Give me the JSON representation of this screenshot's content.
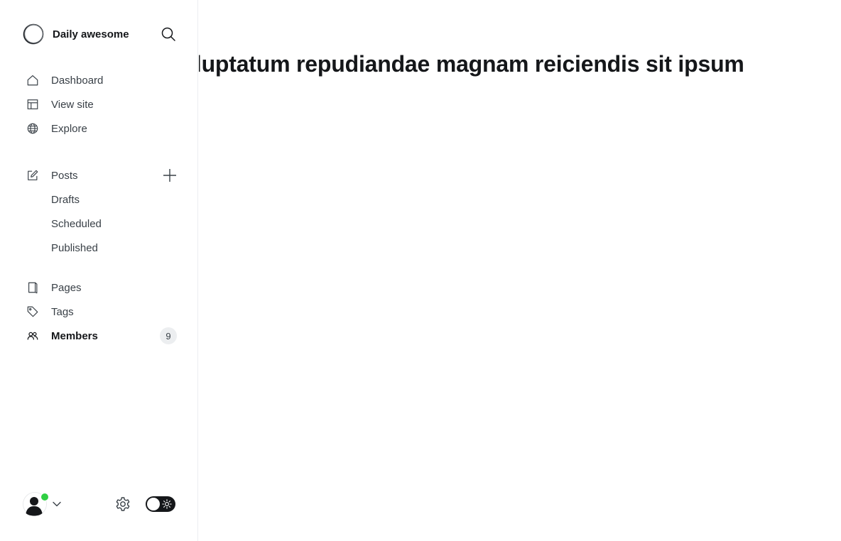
{
  "brand": {
    "title": "Daily awesome",
    "logo_icon": "circle-logo-icon"
  },
  "header": {
    "search_icon": "search-icon"
  },
  "nav": {
    "primary": [
      {
        "label": "Dashboard",
        "icon": "home-icon"
      },
      {
        "label": "View site",
        "icon": "layout-icon"
      },
      {
        "label": "Explore",
        "icon": "globe-icon"
      }
    ],
    "posts": {
      "label": "Posts",
      "icon": "edit-icon",
      "add_icon": "plus-icon",
      "sub": [
        "Drafts",
        "Scheduled",
        "Published"
      ]
    },
    "secondary": [
      {
        "label": "Pages",
        "icon": "page-icon"
      },
      {
        "label": "Tags",
        "icon": "tag-icon"
      },
      {
        "label": "Members",
        "icon": "users-icon",
        "count": "9",
        "active": true
      }
    ]
  },
  "footer": {
    "avatar_icon": "user-avatar-icon",
    "status_color": "#30cf43",
    "chevron_icon": "chevron-down-icon",
    "settings_icon": "gear-icon",
    "theme_toggle_icon": "sun-icon"
  },
  "main": {
    "title": "olorum voluptatum repudiandae magnam reiciendis sit ipsum"
  },
  "colors": {
    "text": "#15171a",
    "muted_text": "#394047",
    "badge_bg": "#eceef0",
    "border": "#ebeef0",
    "online": "#30cf43"
  }
}
